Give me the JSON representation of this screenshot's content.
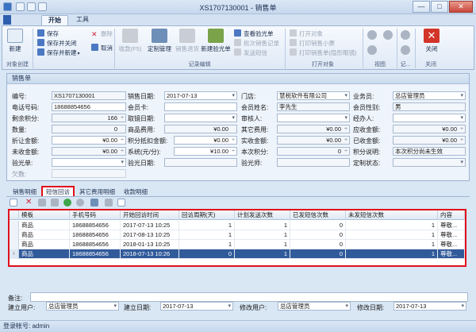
{
  "window": {
    "title": "XS1707130001 - 销售单",
    "controls": [
      "—",
      "□",
      "✕"
    ]
  },
  "ribbon_tabs": [
    "开始",
    "工具"
  ],
  "ribbon": {
    "new_label": "新建",
    "new_group": "对象创建",
    "save": "保存",
    "save_close": "保存并关闭",
    "save_new": "保存并新建",
    "delete": "删除",
    "cancel": "取消",
    "collect": "收款(F5)",
    "custom_manage": "定制管理",
    "sales_return": "销售退货",
    "new_check": "新建验光单",
    "check_bill": "查看验光单",
    "batch_check": "批次销售记录",
    "send_sms": "发送短信",
    "record_group": "记录编辑",
    "open_obj": "打开对象",
    "print_ticket": "打印销售小票",
    "print_bill": "打印销售单(隐形眼镜)",
    "print_group": "打开对象",
    "view_group": "视图",
    "rec_group": "记...",
    "close": "关闭",
    "close_group": "关闭"
  },
  "panel": {
    "title": "销售单",
    "fields": {
      "no_label": "编号:",
      "no": "XS1707130001",
      "date_label": "销售日期:",
      "date": "2017-07-13",
      "store_label": "门店:",
      "store": "慧税软件有限公司",
      "staff_label": "业务员:",
      "staff": "总店管理员",
      "phone_label": "电话号码:",
      "phone": "18688854656",
      "card_label": "会员卡:",
      "card": "",
      "member_label": "会员姓名:",
      "member": "李先生",
      "gender_label": "会员性别:",
      "gender": "男",
      "points_label": "剩余积分:",
      "points": "166",
      "pickup_label": "取镜日期:",
      "pickup": "",
      "audit_label": "审核人:",
      "audit": "",
      "handler_label": "经办人:",
      "handler": "",
      "qty_label": "数量:",
      "qty": "0",
      "goods_label": "商品费用:",
      "goods": "¥0.00",
      "other_label": "其它费用:",
      "other": "¥0.00",
      "due_label": "应收金额:",
      "due": "¥0.00",
      "discount_label": "折让金额:",
      "discount": "¥0.00",
      "pointsdeduct_label": "积分抵扣金额:",
      "pointsdeduct": "¥0.00",
      "actual_label": "实收金额:",
      "actual": "¥0.00",
      "received_label": "已收金额:",
      "received": "¥0.00",
      "unpaid_label": "未收金额:",
      "unpaid": "¥0.00",
      "system_label": "系统(元/分):",
      "system": "¥10.00",
      "thispoints_label": "本次积分:",
      "thispoints": "0",
      "pointsnote_label": "积分说明:",
      "pointsnote": "本次积分尚未生效",
      "optician_label": "验光单:",
      "optician": "",
      "checkdate_label": "验光日期:",
      "checkdate": "",
      "optometrist_label": "验光师:",
      "optometrist": "",
      "customstate_label": "定制状态:",
      "customstate": "",
      "owed_label": "欠数:",
      "owed": ""
    }
  },
  "bottom_tabs": [
    "销售明细",
    "短信回访",
    "其它费用明细",
    "收款明细"
  ],
  "grid": {
    "columns": [
      "模板",
      "手机号码",
      "开始回访时间",
      "回访周期(天)",
      "计划发送次数",
      "已发短信次数",
      "未发短信次数",
      "内容"
    ],
    "rows": [
      [
        "商品",
        "18688854656",
        "2017-07-13 10:25",
        "1",
        "1",
        "0",
        "1",
        "尊敬..."
      ],
      [
        "商品",
        "18688854656",
        "2017-08-13 10:25",
        "1",
        "1",
        "0",
        "1",
        "尊敬..."
      ],
      [
        "商品",
        "18688854656",
        "2018-01-13 10:25",
        "1",
        "1",
        "0",
        "1",
        "尊敬..."
      ],
      [
        "商品",
        "18688854656",
        "2018-07-13 10:26",
        "0",
        "1",
        "0",
        "1",
        "尊敬..."
      ]
    ]
  },
  "footer": {
    "remark_label": "备注:",
    "creator_label": "建立用户:",
    "creator": "总店管理员",
    "createdate_label": "建立日期:",
    "createdate": "2017-07-13",
    "modifier_label": "修改用户:",
    "modifier": "总店管理员",
    "modifydate_label": "修改日期:",
    "modifydate": "2017-07-13"
  },
  "status": "登录帐号: admin",
  "colors": {
    "accent": "#315a9a",
    "highlight": "#e0101a"
  }
}
